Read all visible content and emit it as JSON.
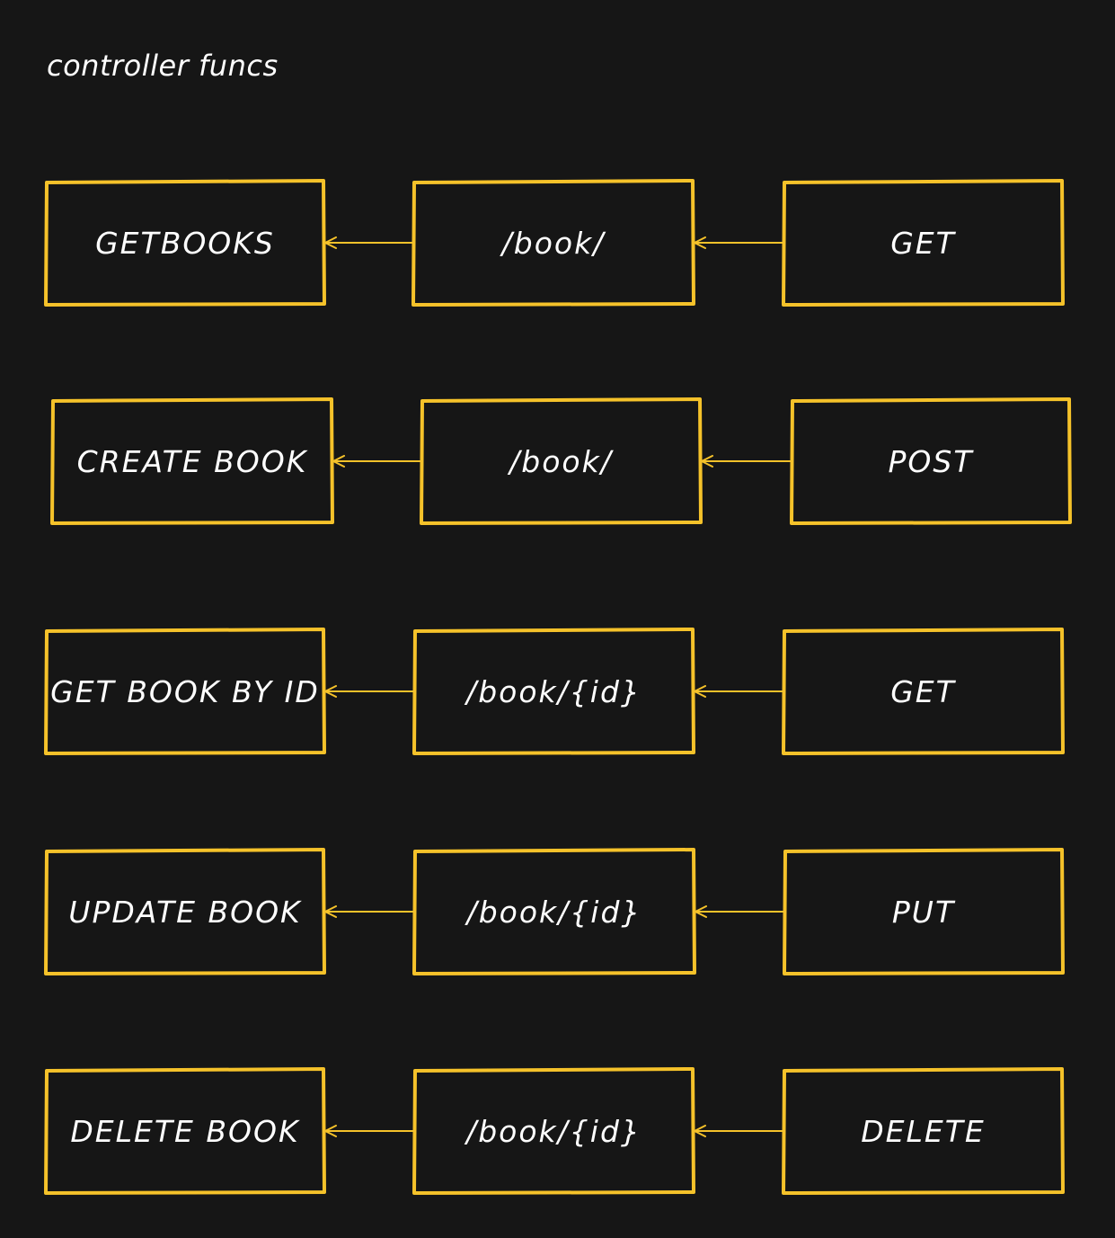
{
  "title": "controller funcs",
  "colors": {
    "background": "#161616",
    "stroke": "#f5c22a",
    "text": "#ffffff"
  },
  "rows": [
    {
      "func": "GETBOOKS",
      "route": "/book/",
      "method": "GET"
    },
    {
      "func": "CREATE BOOK",
      "route": "/book/",
      "method": "POST"
    },
    {
      "func": "GET BOOK BY ID",
      "route": "/book/{id}",
      "method": "GET"
    },
    {
      "func": "UPDATE BOOK",
      "route": "/book/{id}",
      "method": "PUT"
    },
    {
      "func": "DELETE BOOK",
      "route": "/book/{id}",
      "method": "DELETE"
    }
  ]
}
